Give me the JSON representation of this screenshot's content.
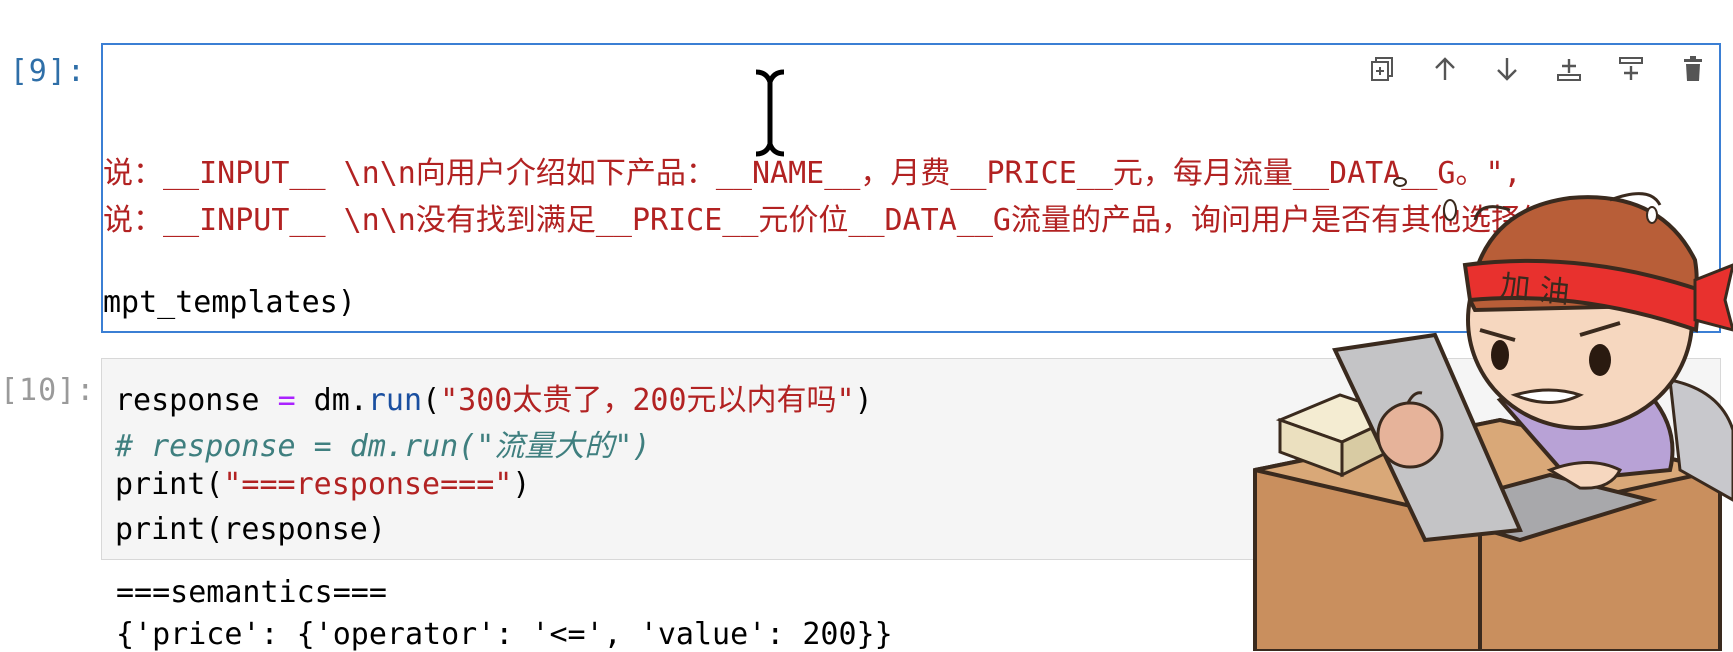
{
  "cells": [
    {
      "prompt": "[9]:",
      "lines": [
        {
          "pre": "说：__INPUT__ \\n\\n向用户介绍如下产品：__NAME__，月费__PRICE__元，每月流量__DATA__G。\",",
          "kind": "string"
        },
        {
          "pre": "说：__INPUT__ \\n\\n没有找到满足__PRICE__元价位__DATA__G流量的产品，询问用户是否有其他选择倾向。",
          "kind": "string"
        },
        {
          "pre": "mpt_templates)",
          "kind": "plain"
        }
      ],
      "toolbar": [
        "duplicate-icon",
        "move-up-icon",
        "move-down-icon",
        "insert-above-icon",
        "insert-below-icon",
        "delete-icon"
      ]
    },
    {
      "prompt": "[10]:",
      "line1": {
        "var": "response ",
        "eq": "=",
        "obj": " dm.",
        "fn": "run",
        "open": "(",
        "str": "\"300太贵了，200元以内有吗\"",
        "close": ")"
      },
      "line2": "# response = dm.run(\"流量大的\")",
      "line3": {
        "fn": "print(",
        "str": "\"===response===\"",
        "close": ")"
      },
      "line4": "print(response)"
    }
  ],
  "output": {
    "line1": "===semantics===",
    "line2": "{'price': {'operator': '<=', 'value': 200}}"
  },
  "sticker": {
    "headband_text": "加 油"
  },
  "colors": {
    "selected_border": "#3b7fd4",
    "string": "#b22222",
    "comment": "#3f7f7f",
    "operator": "#aa22ff",
    "prompt_active": "#2f6fa8",
    "prompt_inactive": "#9a9a9a"
  }
}
